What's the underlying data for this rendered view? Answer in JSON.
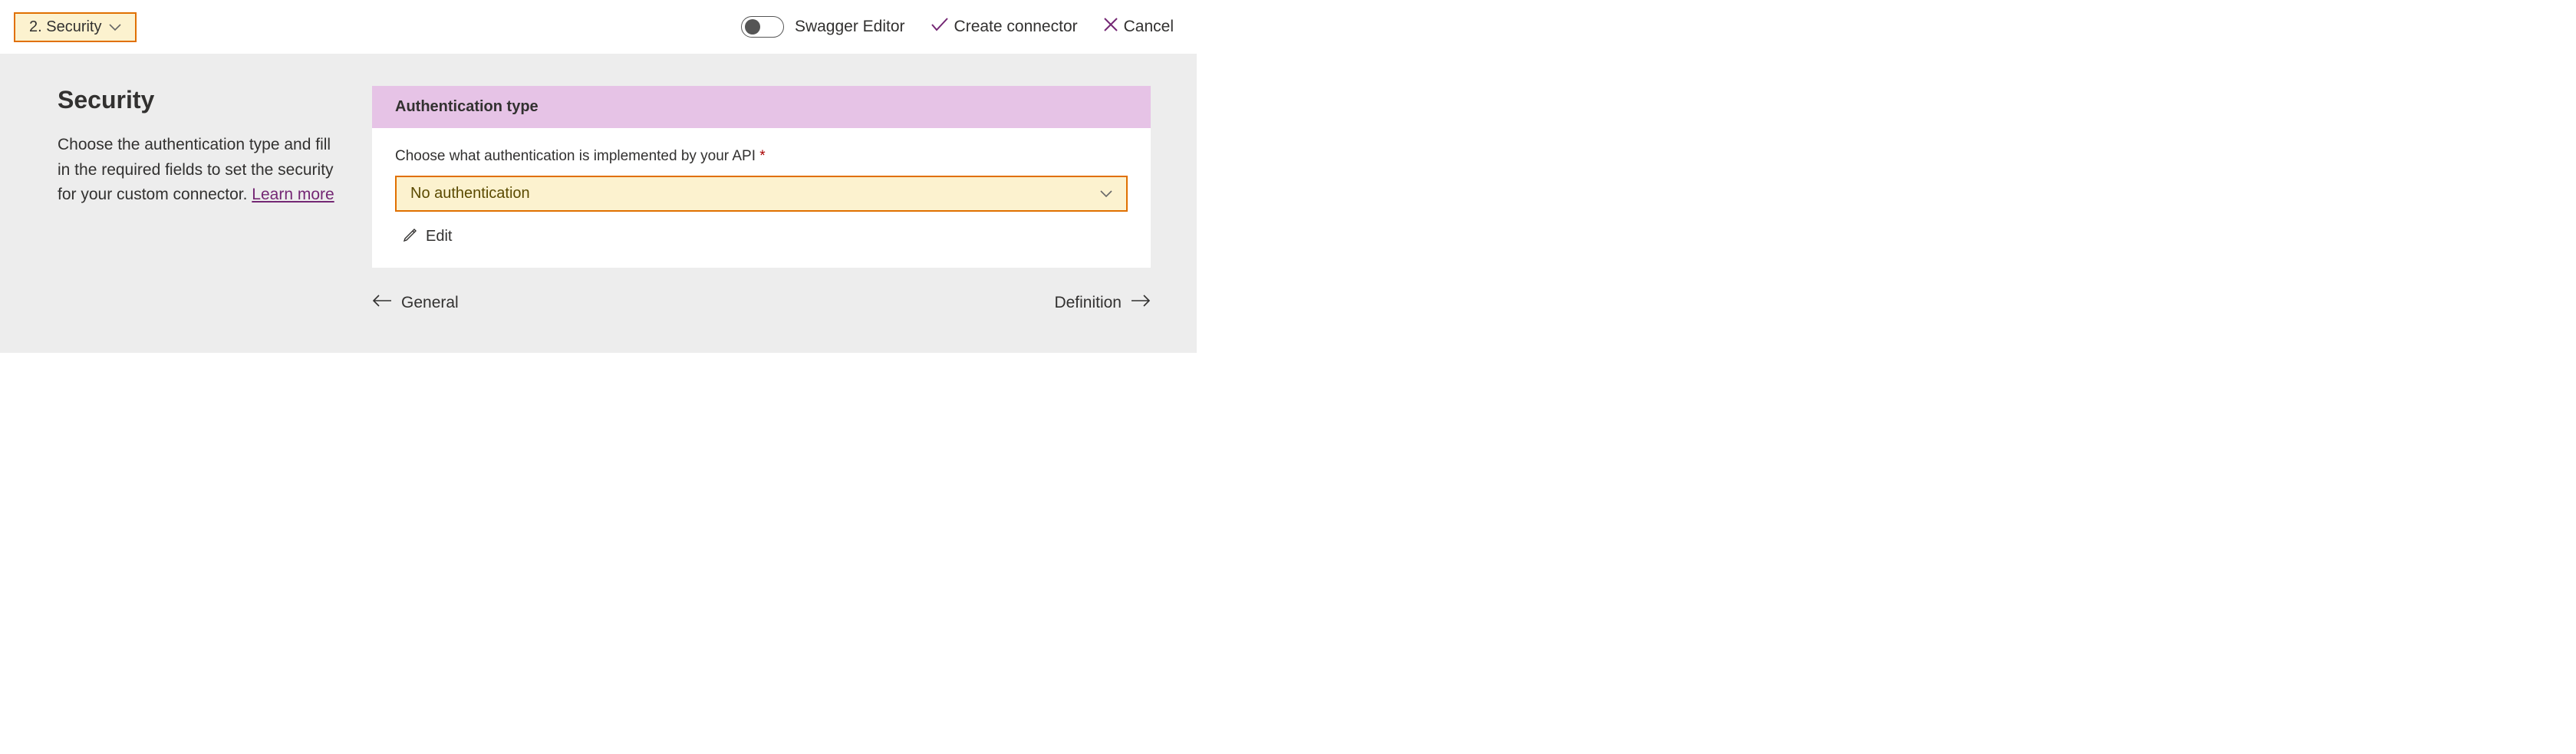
{
  "topbar": {
    "step_label": "2. Security",
    "swagger_label": "Swagger Editor",
    "create_label": "Create connector",
    "cancel_label": "Cancel"
  },
  "left": {
    "heading": "Security",
    "description_pre": "Choose the authentication type and fill in the required fields to set the security for your custom connector. ",
    "learn_more": "Learn more"
  },
  "card": {
    "header": "Authentication type",
    "field_label": "Choose what authentication is implemented by your API",
    "required_mark": "*",
    "selected": "No authentication",
    "edit_label": "Edit"
  },
  "nav": {
    "prev": "General",
    "next": "Definition"
  }
}
